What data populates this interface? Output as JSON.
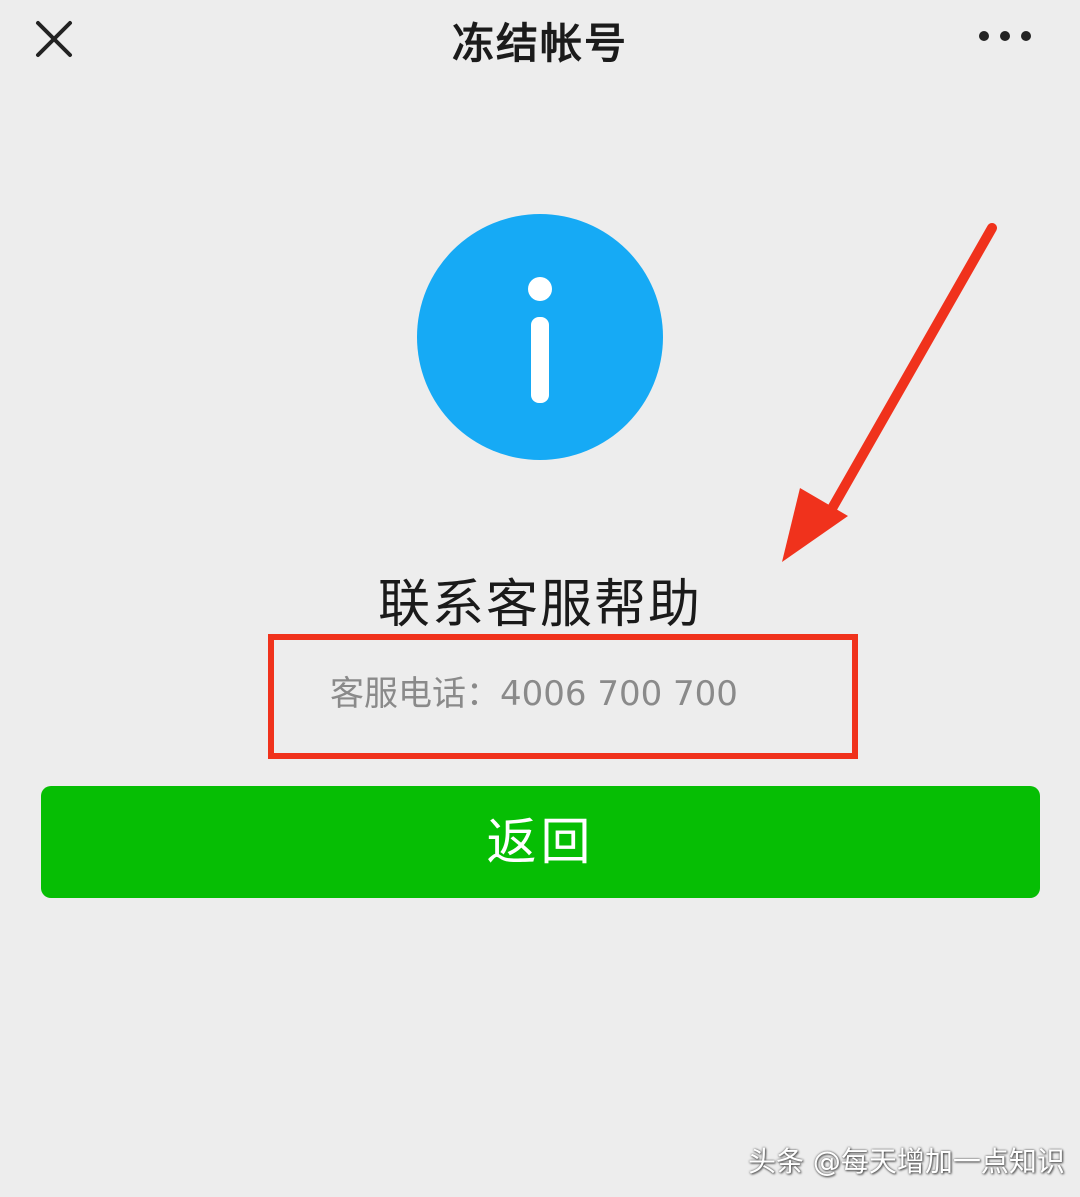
{
  "navbar": {
    "close_icon": "close-icon",
    "title": "冻结帐号",
    "more_icon": "more-horizontal-icon"
  },
  "main": {
    "info_icon": "info-icon",
    "headline": "联系客服帮助",
    "phone_label": "客服电话：",
    "phone_number": "4006 700 700"
  },
  "back_button_label": "返回",
  "annotation": {
    "arrow_icon": "red-arrow-icon",
    "highlight_color": "#f0321c"
  },
  "watermark": "头条 @每天增加一点知识",
  "colors": {
    "background": "#ededed",
    "info_blue": "#16aaf5",
    "button_green": "#06be04"
  }
}
